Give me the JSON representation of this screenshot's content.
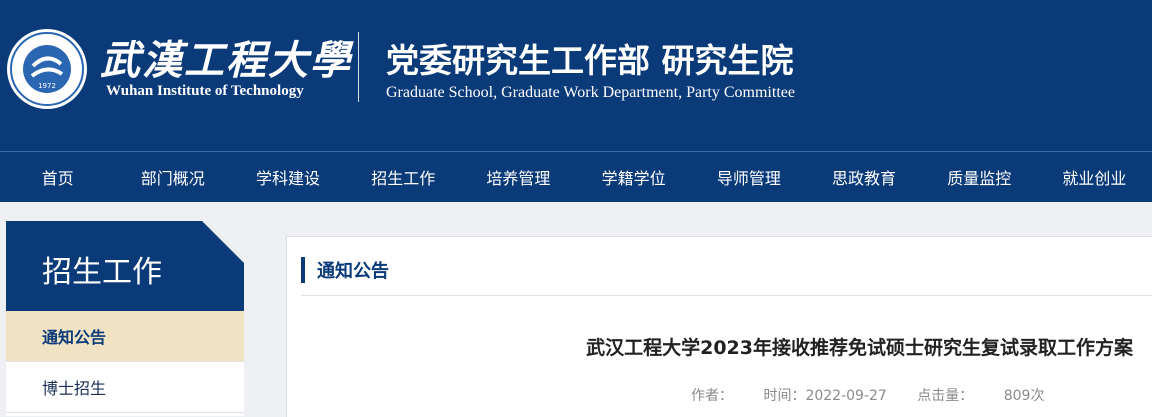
{
  "header": {
    "school_name_cn": "武漢工程大學",
    "school_name_en": "Wuhan Institute of Technology",
    "seal_year": "1972",
    "dept_name_cn": "党委研究生工作部  研究生院",
    "dept_name_en": "Graduate School, Graduate Work Department, Party Committee"
  },
  "nav": {
    "items": [
      "首页",
      "部门概况",
      "学科建设",
      "招生工作",
      "培养管理",
      "学籍学位",
      "导师管理",
      "思政教育",
      "质量监控",
      "就业创业"
    ]
  },
  "sidebar": {
    "title": "招生工作",
    "items": [
      "通知公告",
      "博士招生"
    ]
  },
  "content": {
    "section_title": "通知公告",
    "article_title": "武汉工程大学2023年接收推荐免试硕士研究生复试录取工作方案",
    "meta": {
      "author_label": "作者：",
      "time_label": "时间：",
      "time_value": "2022-09-27",
      "views_label": "点击量：",
      "views_value": "809次"
    }
  },
  "colors": {
    "brand_blue": "#0a3a78",
    "active_item_bg": "#efe3c4",
    "page_bg": "#eef0f3"
  }
}
